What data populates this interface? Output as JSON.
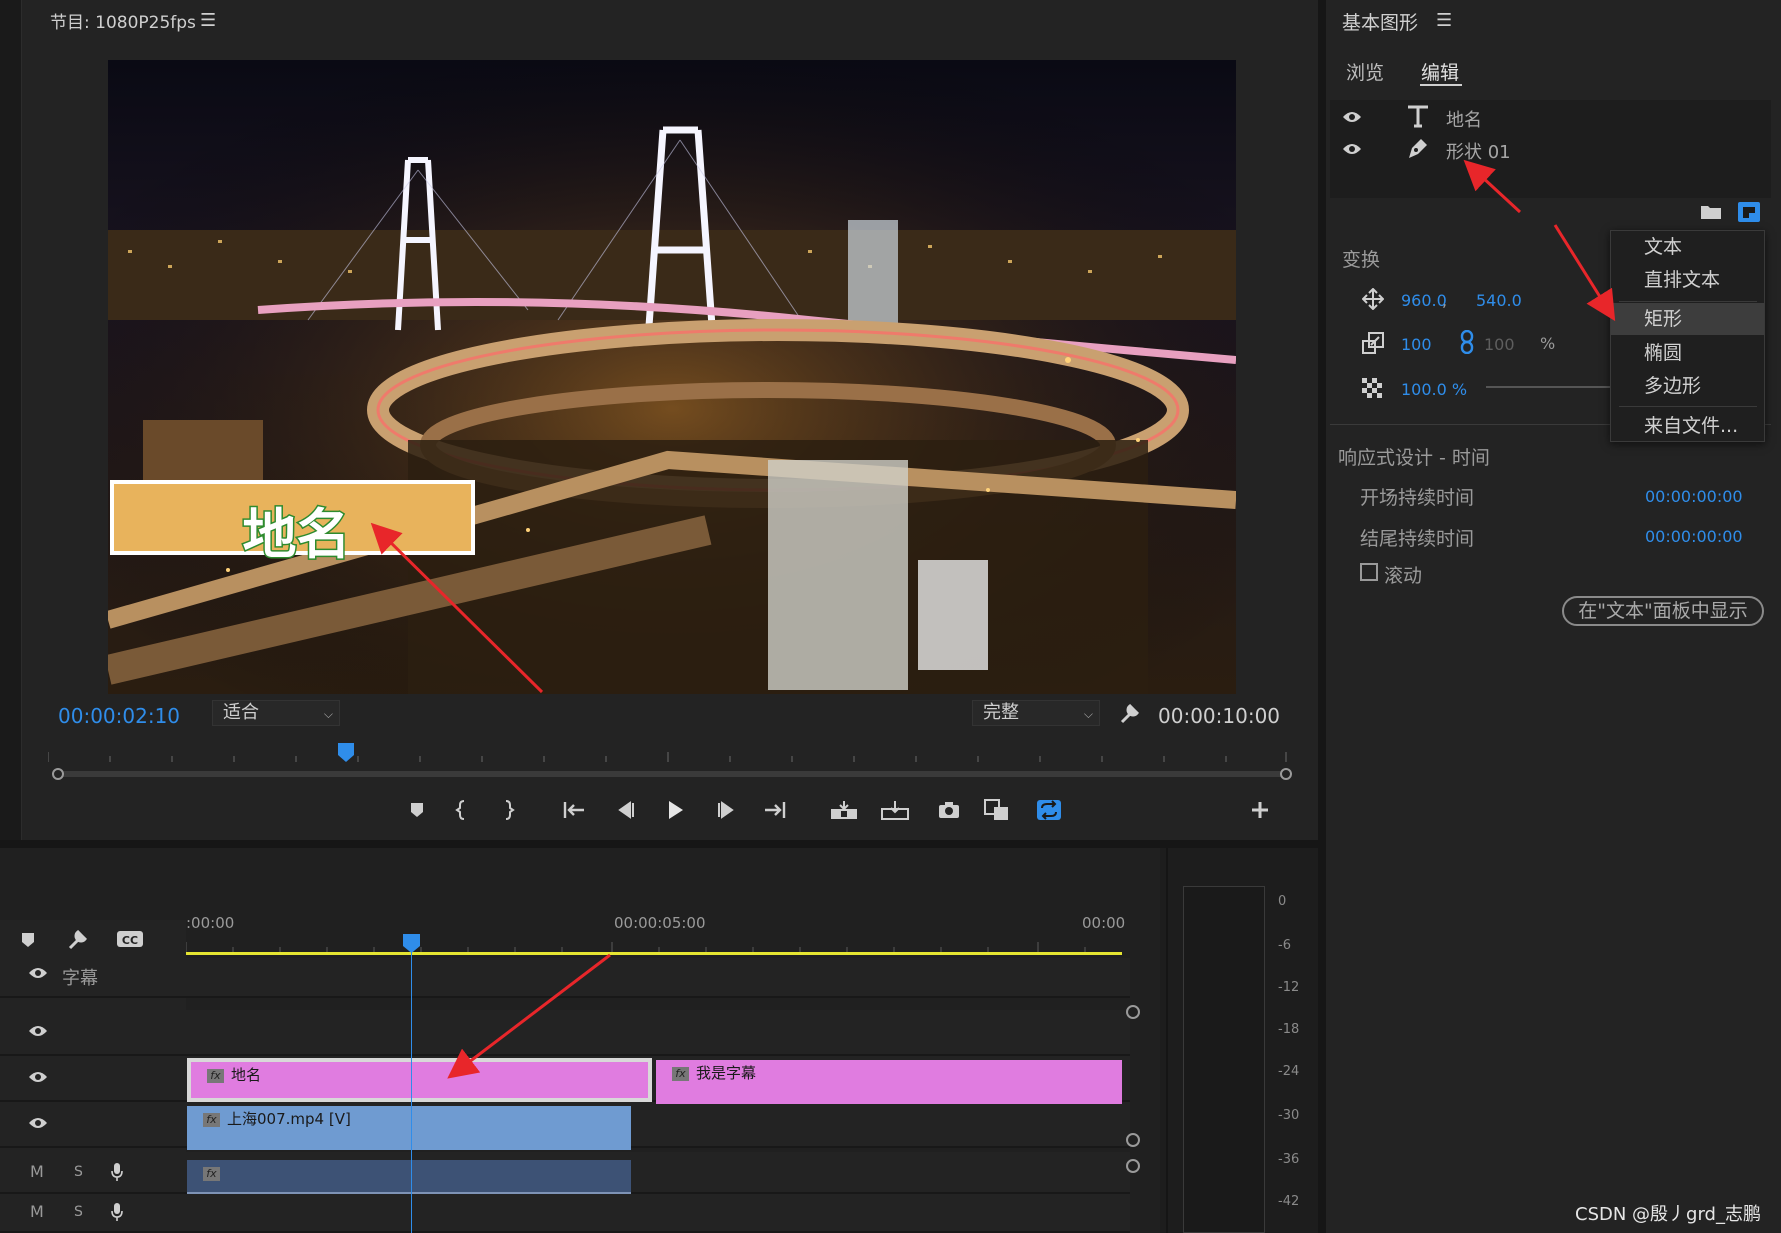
{
  "program_monitor": {
    "title": "节目: 1080P25fps",
    "current_timecode": "00:00:02:10",
    "fit_value": "适合",
    "quality_value": "完整",
    "duration_timecode": "00:00:10:00",
    "lower_third_text": "地名",
    "lower_third_color": "#e8b35c"
  },
  "timeline": {
    "ruler_labels": [
      ":00:00",
      "00:00:05:00",
      "00:00"
    ],
    "caption_track_label": "字幕",
    "track_mute_label": "M",
    "track_solo_label": "S",
    "clips": {
      "title_clip": "地名",
      "subtitle_clip": "我是字幕",
      "video_clip": "上海007.mp4 [V]",
      "fx_label": "fx"
    },
    "clip_colors": {
      "graphics": "#e07ce0",
      "video": "#6f9bd1",
      "audio": "#3d5275"
    }
  },
  "audio_meter": {
    "db_labels": [
      "0",
      "-6",
      "-12",
      "-18",
      "-24",
      "-30",
      "-36",
      "-42"
    ]
  },
  "essential_graphics": {
    "title": "基本图形",
    "tabs": [
      {
        "label": "浏览"
      },
      {
        "label": "编辑"
      }
    ],
    "layers": [
      {
        "name": "地名",
        "icon": "text-icon"
      },
      {
        "name": "形状 01",
        "icon": "pen-icon"
      }
    ],
    "transform_heading": "变换",
    "position_x": "960.0",
    "position_y": "540.0",
    "scale": "100",
    "scale_locked": "100",
    "scale_unit": "%",
    "opacity": "100.0 %",
    "responsive_heading": "响应式设计 - 时间",
    "intro_label": "开场持续时间",
    "intro_value": "00:00:00:00",
    "outro_label": "结尾持续时间",
    "outro_value": "00:00:00:00",
    "roll_label": "滚动",
    "show_in_text_button": "在\"文本\"面板中显示"
  },
  "new_layer_menu": {
    "items": [
      "文本",
      "直排文本",
      "矩形",
      "椭圆",
      "多边形",
      "来自文件..."
    ],
    "highlighted": "矩形"
  },
  "watermark": "CSDN @殷丿grd_志鹏",
  "accent_color": "#2f8dea"
}
